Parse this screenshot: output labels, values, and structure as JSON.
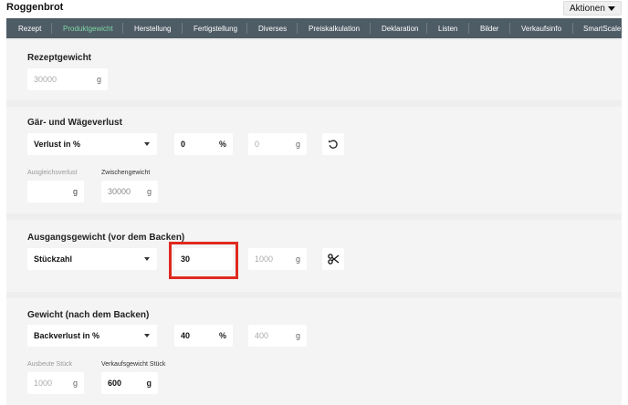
{
  "header": {
    "title": "Roggenbrot",
    "actions_label": "Aktionen"
  },
  "tabs": [
    {
      "label": "Rezept"
    },
    {
      "label": "Produktgewicht"
    },
    {
      "label": "Herstellung"
    },
    {
      "label": "Fertigstellung"
    },
    {
      "label": "Diverses"
    },
    {
      "label": "Preiskalkulation"
    },
    {
      "label": "Deklaration"
    },
    {
      "label": "Listen"
    },
    {
      "label": "Bilder"
    },
    {
      "label": "Verkaufsinfo"
    },
    {
      "label": "SmartScale"
    }
  ],
  "active_tab": "Produktgewicht",
  "colors": {
    "tab_bar": "#4e5c66",
    "active_tab": "#7fd7a4",
    "highlight": "#e0291f"
  },
  "sections": {
    "recipe_weight": {
      "title": "Rezeptgewicht",
      "value": "30000",
      "unit": "g"
    },
    "loss": {
      "title": "Gär- und Wägeverlust",
      "mode": "Verlust in %",
      "percent_value": "0",
      "percent_unit": "%",
      "gram_value": "0",
      "gram_unit": "g",
      "reset_icon": "undo-icon",
      "compensation_label": "Ausgleichsverlust",
      "compensation_value": "",
      "compensation_unit": "g",
      "intermediate_label": "Zwischengewicht",
      "intermediate_value": "30000",
      "intermediate_unit": "g"
    },
    "output_weight": {
      "title": "Ausgangsgewicht (vor dem Backen)",
      "mode": "Stückzahl",
      "count_value": "30",
      "weight_value": "1000",
      "weight_unit": "g",
      "split_icon": "scissors-icon"
    },
    "weight_after": {
      "title": "Gewicht (nach dem Backen)",
      "mode": "Backverlust in %",
      "percent_value": "40",
      "percent_unit": "%",
      "gram_value": "400",
      "gram_unit": "g",
      "yield_label": "Ausbeute Stück",
      "yield_value": "1000",
      "yield_unit": "g",
      "sale_weight_label": "Verkaufsgewicht Stück",
      "sale_weight_value": "600",
      "sale_weight_unit": "g"
    }
  }
}
